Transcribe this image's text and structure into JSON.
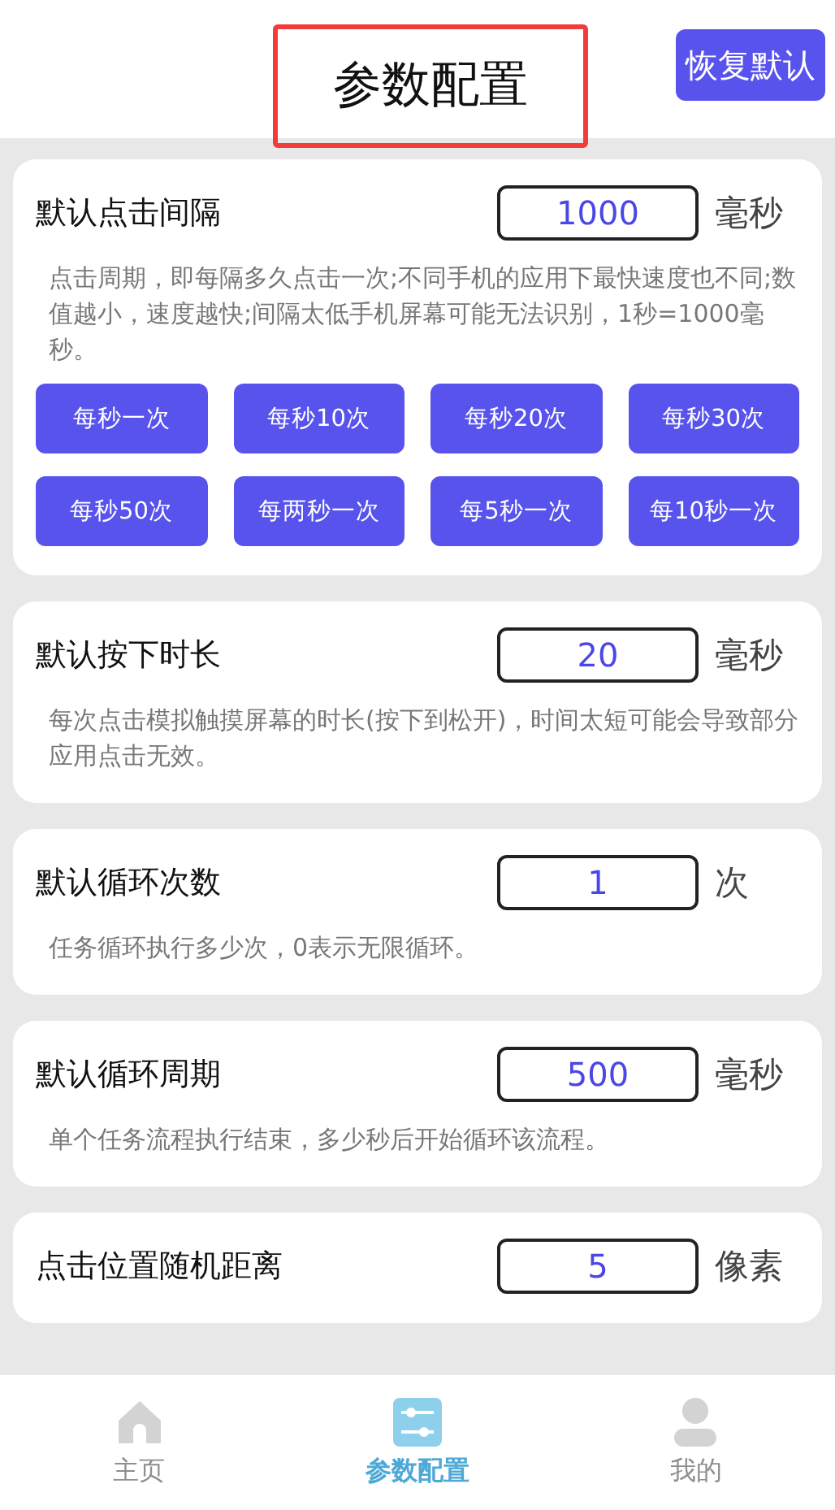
{
  "header": {
    "title": "参数配置",
    "title_highlighted": true,
    "action": "恢复默认"
  },
  "settings": [
    {
      "label": "默认点击间隔",
      "value": "1000",
      "unit": "毫秒",
      "description": "点击周期，即每隔多久点击一次;不同手机的应用下最快速度也不同;数值越小，速度越快;间隔太低手机屏幕可能无法识别，1秒=1000毫秒。",
      "presets": [
        "每秒一次",
        "每秒10次",
        "每秒20次",
        "每秒30次",
        "每秒50次",
        "每两秒一次",
        "每5秒一次",
        "每10秒一次"
      ]
    },
    {
      "label": "默认按下时长",
      "value": "20",
      "unit": "毫秒",
      "description": "每次点击模拟触摸屏幕的时长(按下到松开)，时间太短可能会导致部分应用点击无效。"
    },
    {
      "label": "默认循环次数",
      "value": "1",
      "unit": "次",
      "description": "任务循环执行多少次，0表示无限循环。"
    },
    {
      "label": "默认循环周期",
      "value": "500",
      "unit": "毫秒",
      "description": "单个任务流程执行结束，多少秒后开始循环该流程。"
    },
    {
      "label": "点击位置随机距离",
      "value": "5",
      "unit": "像素"
    }
  ],
  "tabs": [
    {
      "kind": "home",
      "label": "主页",
      "selected": false
    },
    {
      "kind": "settings",
      "label": "参数配置",
      "selected": true
    },
    {
      "kind": "profile",
      "label": "我的",
      "selected": false
    }
  ]
}
